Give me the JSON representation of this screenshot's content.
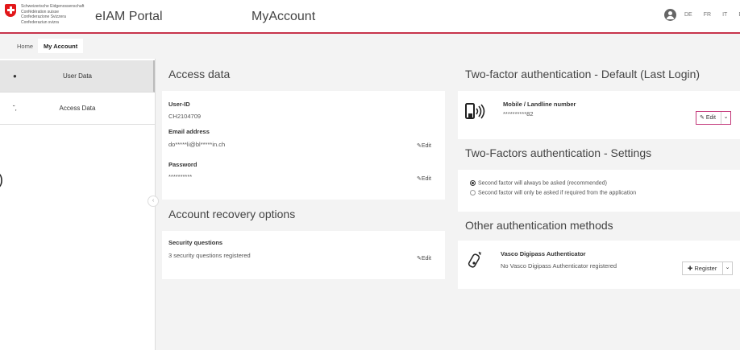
{
  "header": {
    "confederation_lines": [
      "Schweizerische Eidgenossenschaft",
      "Confédération suisse",
      "Confederazione Svizzera",
      "Confederaziun svizra"
    ],
    "portal_title": "eIAM Portal",
    "page_title": "MyAccount",
    "languages": [
      "DE",
      "FR",
      "IT",
      "E"
    ]
  },
  "tabs": [
    {
      "label": "Home",
      "active": false
    },
    {
      "label": "My Account",
      "active": true
    }
  ],
  "sidebar": {
    "items": [
      {
        "label": "User Data",
        "icon": "user-icon",
        "active": true
      },
      {
        "label": "Access Data",
        "icon": "key-icon",
        "active": false
      }
    ]
  },
  "access_data": {
    "title": "Access data",
    "user_id_label": "User-ID",
    "user_id_value": "CH2104709",
    "email_label": "Email address",
    "email_value": "do*****li@bl*****in.ch",
    "password_label": "Password",
    "password_value": "**********",
    "edit_label": "Edit"
  },
  "recovery": {
    "title": "Account recovery options",
    "security_label": "Security questions",
    "security_value": "3 security questions registered",
    "edit_label": "Edit"
  },
  "two_factor_default": {
    "title": "Two-factor authentication - Default (Last Login)",
    "method_label": "Mobile / Landline number",
    "method_value": "**********82",
    "edit_label": "Edit",
    "accent": "#c33779"
  },
  "two_factor_settings": {
    "title": "Two-Factors authentication - Settings",
    "options": [
      {
        "label": "Second factor will always be asked (recommended)",
        "checked": true
      },
      {
        "label": "Second factor will only be asked if required from the application",
        "checked": false
      }
    ]
  },
  "other_methods": {
    "title": "Other authentication methods",
    "method_label": "Vasco Digipass Authenticator",
    "method_value": "No Vasco Digipass Authenticator registered",
    "register_label": "Register"
  },
  "colors": {
    "header_border": "#c7334b",
    "swiss_red": "#e2171a"
  }
}
